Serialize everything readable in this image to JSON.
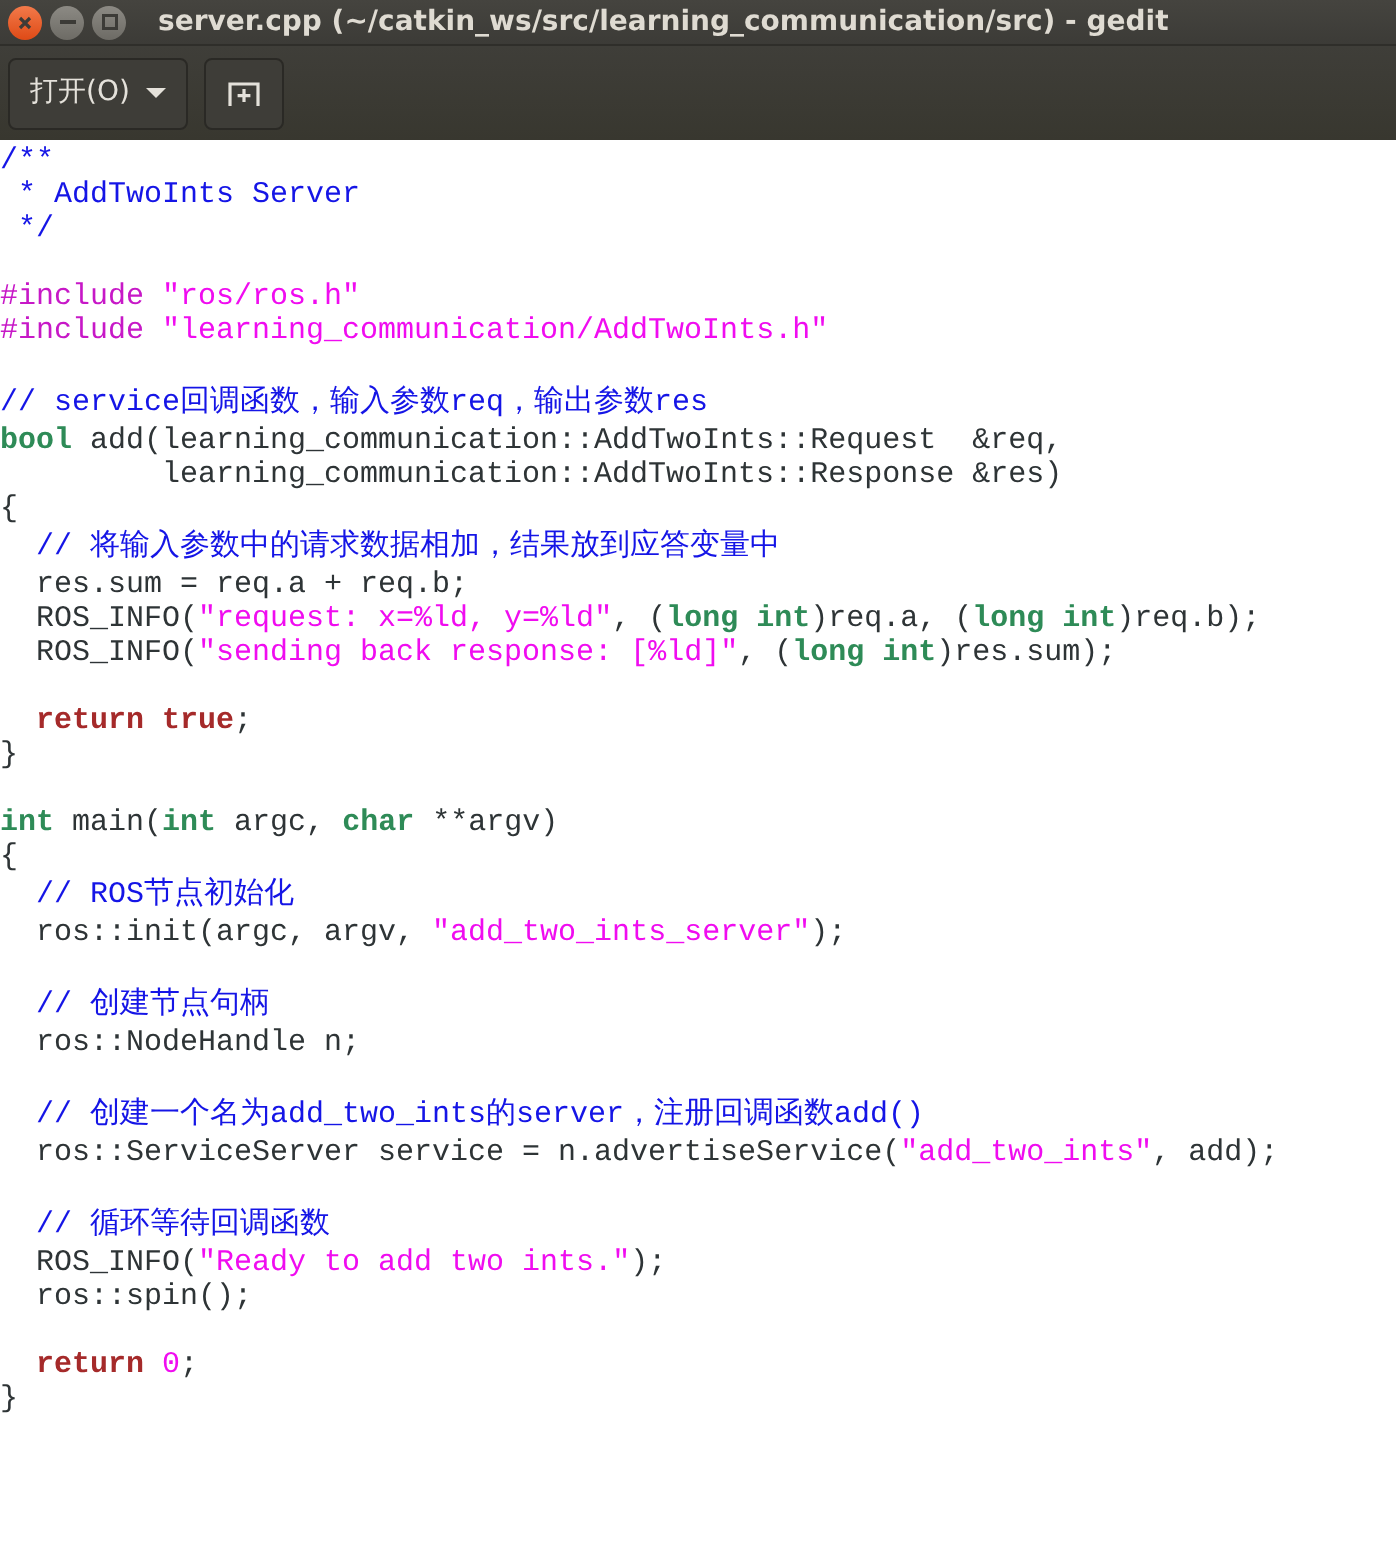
{
  "window": {
    "title": "server.cpp (~/catkin_ws/src/learning_communication/src) - gedit"
  },
  "toolbar": {
    "open_button": {
      "label": "打开(O)"
    }
  },
  "editor": {
    "lines": [
      {
        "kind": "code",
        "segments": [
          {
            "kind": "comment",
            "text": "/**"
          }
        ]
      },
      {
        "kind": "code",
        "segments": [
          {
            "kind": "comment",
            "text": " * AddTwoInts Server"
          }
        ]
      },
      {
        "kind": "code",
        "segments": [
          {
            "kind": "comment",
            "text": " */"
          }
        ]
      },
      {
        "kind": "blank"
      },
      {
        "kind": "code",
        "segments": [
          {
            "kind": "preproc",
            "text": "#include "
          },
          {
            "kind": "string",
            "text": "\"ros/ros.h\""
          }
        ]
      },
      {
        "kind": "code",
        "segments": [
          {
            "kind": "preproc",
            "text": "#include "
          },
          {
            "kind": "string",
            "text": "\"learning_communication/AddTwoInts.h\""
          }
        ]
      },
      {
        "kind": "blank"
      },
      {
        "kind": "code",
        "segments": [
          {
            "kind": "comment",
            "text": "// service回调函数，输入参数req，输出参数res"
          }
        ]
      },
      {
        "kind": "code",
        "segments": [
          {
            "kind": "type",
            "text": "bool"
          },
          {
            "kind": "plain",
            "text": " add(learning_communication::AddTwoInts::Request  &req,"
          }
        ]
      },
      {
        "kind": "code",
        "segments": [
          {
            "kind": "plain",
            "text": "         learning_communication::AddTwoInts::Response &res)"
          }
        ]
      },
      {
        "kind": "code",
        "segments": [
          {
            "kind": "plain",
            "text": "{"
          }
        ]
      },
      {
        "kind": "code",
        "segments": [
          {
            "kind": "comment",
            "text": "  // 将输入参数中的请求数据相加，结果放到应答变量中"
          }
        ]
      },
      {
        "kind": "code",
        "segments": [
          {
            "kind": "plain",
            "text": "  res.sum = req.a + req.b;"
          }
        ]
      },
      {
        "kind": "code",
        "segments": [
          {
            "kind": "plain",
            "text": "  ROS_INFO("
          },
          {
            "kind": "string",
            "text": "\"request: x=%ld, y=%ld\""
          },
          {
            "kind": "plain",
            "text": ", ("
          },
          {
            "kind": "type",
            "text": "long int"
          },
          {
            "kind": "plain",
            "text": ")req.a, ("
          },
          {
            "kind": "type",
            "text": "long int"
          },
          {
            "kind": "plain",
            "text": ")req.b);"
          }
        ]
      },
      {
        "kind": "code",
        "segments": [
          {
            "kind": "plain",
            "text": "  ROS_INFO("
          },
          {
            "kind": "string",
            "text": "\"sending back response: [%ld]\""
          },
          {
            "kind": "plain",
            "text": ", ("
          },
          {
            "kind": "type",
            "text": "long int"
          },
          {
            "kind": "plain",
            "text": ")res.sum);"
          }
        ]
      },
      {
        "kind": "blank"
      },
      {
        "kind": "code",
        "segments": [
          {
            "kind": "keyword",
            "text": "  return true"
          },
          {
            "kind": "plain",
            "text": ";"
          }
        ]
      },
      {
        "kind": "code",
        "segments": [
          {
            "kind": "plain",
            "text": "}"
          }
        ]
      },
      {
        "kind": "blank"
      },
      {
        "kind": "code",
        "segments": [
          {
            "kind": "type",
            "text": "int"
          },
          {
            "kind": "plain",
            "text": " main("
          },
          {
            "kind": "type",
            "text": "int"
          },
          {
            "kind": "plain",
            "text": " argc, "
          },
          {
            "kind": "type",
            "text": "char"
          },
          {
            "kind": "plain",
            "text": " **argv)"
          }
        ]
      },
      {
        "kind": "code",
        "segments": [
          {
            "kind": "plain",
            "text": "{"
          }
        ]
      },
      {
        "kind": "code",
        "segments": [
          {
            "kind": "comment",
            "text": "  // ROS节点初始化"
          }
        ]
      },
      {
        "kind": "code",
        "segments": [
          {
            "kind": "plain",
            "text": "  ros::init(argc, argv, "
          },
          {
            "kind": "string",
            "text": "\"add_two_ints_server\""
          },
          {
            "kind": "plain",
            "text": ");"
          }
        ]
      },
      {
        "kind": "blank"
      },
      {
        "kind": "code",
        "segments": [
          {
            "kind": "comment",
            "text": "  // 创建节点句柄"
          }
        ]
      },
      {
        "kind": "code",
        "segments": [
          {
            "kind": "plain",
            "text": "  ros::NodeHandle n;"
          }
        ]
      },
      {
        "kind": "blank"
      },
      {
        "kind": "code",
        "segments": [
          {
            "kind": "comment",
            "text": "  // 创建一个名为add_two_ints的server，注册回调函数add()"
          }
        ]
      },
      {
        "kind": "code",
        "segments": [
          {
            "kind": "plain",
            "text": "  ros::ServiceServer service = n.advertiseService("
          },
          {
            "kind": "string",
            "text": "\"add_two_ints\""
          },
          {
            "kind": "plain",
            "text": ", add);"
          }
        ]
      },
      {
        "kind": "blank"
      },
      {
        "kind": "code",
        "segments": [
          {
            "kind": "comment",
            "text": "  // 循环等待回调函数"
          }
        ]
      },
      {
        "kind": "code",
        "segments": [
          {
            "kind": "plain",
            "text": "  ROS_INFO("
          },
          {
            "kind": "string",
            "text": "\"Ready to add two ints.\""
          },
          {
            "kind": "plain",
            "text": ");"
          }
        ]
      },
      {
        "kind": "code",
        "segments": [
          {
            "kind": "plain",
            "text": "  ros::spin();"
          }
        ]
      },
      {
        "kind": "blank"
      },
      {
        "kind": "code",
        "segments": [
          {
            "kind": "keyword",
            "text": "  return "
          },
          {
            "kind": "number",
            "text": "0"
          },
          {
            "kind": "plain",
            "text": ";"
          }
        ]
      },
      {
        "kind": "code",
        "segments": [
          {
            "kind": "plain",
            "text": "}"
          }
        ]
      }
    ]
  }
}
